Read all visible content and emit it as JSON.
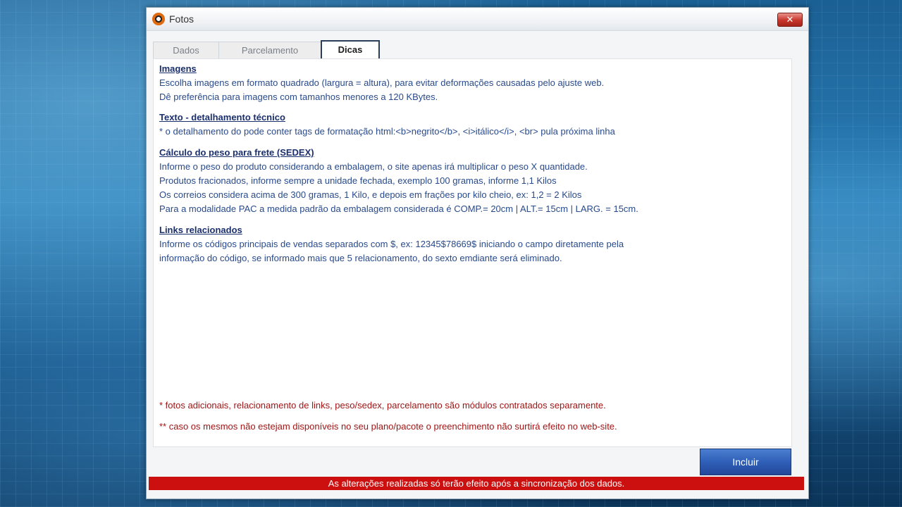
{
  "window": {
    "title": "Fotos",
    "close_glyph": "✕"
  },
  "tabs": [
    {
      "label": "Dados",
      "active": false
    },
    {
      "label": "Parcelamento",
      "active": false
    },
    {
      "label": "Dicas",
      "active": true
    }
  ],
  "sections": [
    {
      "heading": "Imagens",
      "lines": [
        "Escolha imagens em formato quadrado (largura = altura), para evitar deformações causadas pelo ajuste web.",
        "Dê preferência para imagens com tamanhos menores a 120 KBytes."
      ]
    },
    {
      "heading": "Texto - detalhamento técnico",
      "lines": [
        "* o detalhamento do pode conter tags de formatação html:<b>negrito</b>, <i>itálico</i>, <br> pula próxima linha"
      ]
    },
    {
      "heading": "Cálculo do peso para frete (SEDEX)",
      "lines": [
        "Informe o peso do produto considerando a embalagem, o site apenas irá multiplicar o peso X quantidade.",
        "Produtos fracionados, informe sempre a unidade fechada, exemplo 100 gramas, informe 1,1 Kilos",
        "Os correios considera acima de 300 gramas, 1 Kilo, e depois em frações por kilo cheio, ex: 1,2 = 2 Kilos",
        "Para a modalidade PAC a medida padrão da embalagem considerada é COMP.= 20cm | ALT.= 15cm | LARG. = 15cm."
      ]
    },
    {
      "heading": "Links relacionados",
      "lines": [
        "Informe os códigos principais de vendas separados com $, ex: 12345$78669$ iniciando o campo diretamente pela",
        "informação do código, se informado mais que 5 relacionamento, do sexto emdiante será eliminado."
      ]
    }
  ],
  "notes": [
    "* fotos adicionais, relacionamento de links, peso/sedex, parcelamento são módulos contratados separamente.",
    "** caso os mesmos não estejam disponíveis no seu plano/pacote o preenchimento não surtirá efeito no web-site."
  ],
  "buttons": {
    "include_label": "Incluir"
  },
  "status": {
    "message": "As alterações realizadas só terão efeito após a sincronização dos dados."
  },
  "colors": {
    "heading": "#1a2f6c",
    "text": "#284a8c",
    "note": "#a01414",
    "status_bg": "#cc1010",
    "button_bg": "#2f5fb8"
  }
}
